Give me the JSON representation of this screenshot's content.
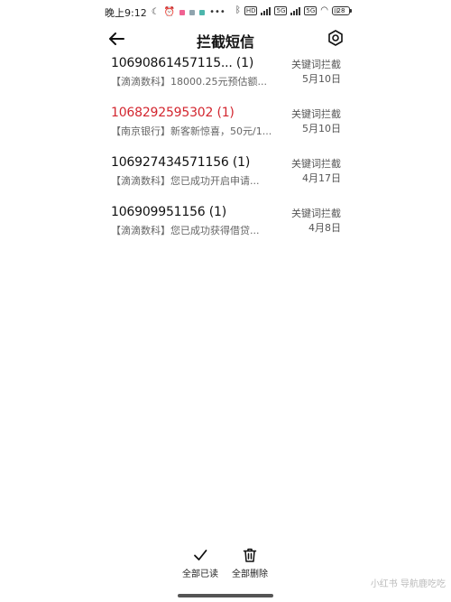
{
  "status_bar": {
    "time": "晚上9:12",
    "network_tags": [
      "5G",
      "5G"
    ],
    "battery": "28",
    "colors": {
      "notif_1": "#f06292",
      "notif_2": "#90a4ae",
      "notif_3": "#4db6ac"
    }
  },
  "app_bar": {
    "title": "拦截短信",
    "back_icon": "arrow-left-icon",
    "settings_icon": "settings-hex-icon"
  },
  "messages": [
    {
      "sender": "10690861457115... (1)",
      "preview": "【滴滴数科】18000.25元预估额...",
      "tag": "关键词拦截",
      "date": "5月10日",
      "highlight": false
    },
    {
      "sender": "1068292595302 (1)",
      "preview": "【南京银行】新客新惊喜，50元/1...",
      "tag": "关键词拦截",
      "date": "5月10日",
      "highlight": true
    },
    {
      "sender": "106927434571156 (1)",
      "preview": "【滴滴数科】您已成功开启申请...",
      "tag": "关键词拦截",
      "date": "4月17日",
      "highlight": false
    },
    {
      "sender": "106909951156 (1)",
      "preview": "【滴滴数科】您已成功获得借贷...",
      "tag": "关键词拦截",
      "date": "4月8日",
      "highlight": false
    }
  ],
  "bottom_actions": {
    "mark_all_read": "全部已读",
    "delete_all": "全部删除"
  },
  "watermark": "小红书 导航鹿吃吃",
  "colors": {
    "highlight": "#d3262f",
    "text": "#111111",
    "muted": "#666666"
  }
}
